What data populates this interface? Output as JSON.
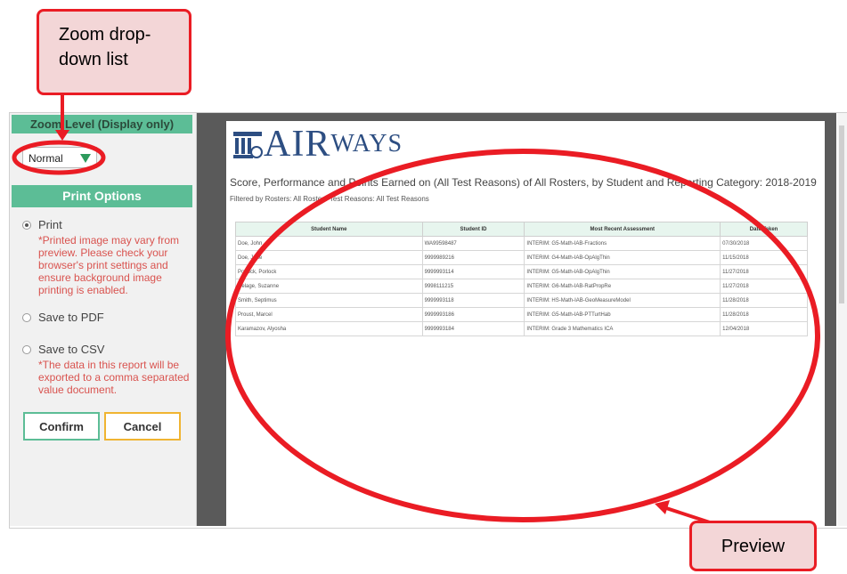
{
  "left_panel": {
    "zoom_header": "Zoom Level (Display only)",
    "zoom_value": "Normal",
    "print_header": "Print Options",
    "options": [
      {
        "label": "Print",
        "selected": true
      },
      {
        "label": "Save to PDF",
        "selected": false
      },
      {
        "label": "Save to CSV",
        "selected": false
      }
    ],
    "print_note": "*Printed image may vary from preview. Please check your browser's print settings and ensure background image printing is enabled.",
    "csv_note": "*The data in this report will be exported to a comma separated value document.",
    "confirm_label": "Confirm",
    "cancel_label": "Cancel"
  },
  "preview": {
    "logo_main": "AIR",
    "logo_sub": "WAYS",
    "title": "Score, Performance and Points Earned on (All Test Reasons) of All Rosters, by Student and Reporting Category: 2018-2019",
    "filter": "Filtered by Rosters: All Rosters Test Reasons: All Test Reasons",
    "columns": [
      "Student Name",
      "Student ID",
      "Most Recent Assessment",
      "Date Taken"
    ],
    "rows": [
      [
        "Doe, John",
        "WA99598487",
        "INTERIM: G5-Math-IAB-Fractions",
        "07/30/2018"
      ],
      [
        "Doe, Jane",
        "9999989216",
        "INTERIM: G4-Math-IAB-OpAlgThin",
        "11/15/2018"
      ],
      [
        "Porlock, Porlock",
        "9999993114",
        "INTERIM: G5-Math-IAB-OpAlgThin",
        "11/27/2018"
      ],
      [
        "Delage, Suzanne",
        "9998111215",
        "INTERIM: G6-Math-IAB-RatPropRe",
        "11/27/2018"
      ],
      [
        "Smith, Septimus",
        "9999993118",
        "INTERIM: HS-Math-IAB-GeoMeasureModel",
        "11/28/2018"
      ],
      [
        "Proust, Marcel",
        "9999993186",
        "INTERIM: G5-Math-IAB-PTTurtHab",
        "11/28/2018"
      ],
      [
        "Karamazov, Alyosha",
        "9999993184",
        "INTERIM: Grade 3 Mathematics ICA",
        "12/04/2018"
      ]
    ]
  },
  "annotations": {
    "zoom_callout": "Zoom drop-down list",
    "preview_callout": "Preview",
    "color": "#ea1c24"
  }
}
